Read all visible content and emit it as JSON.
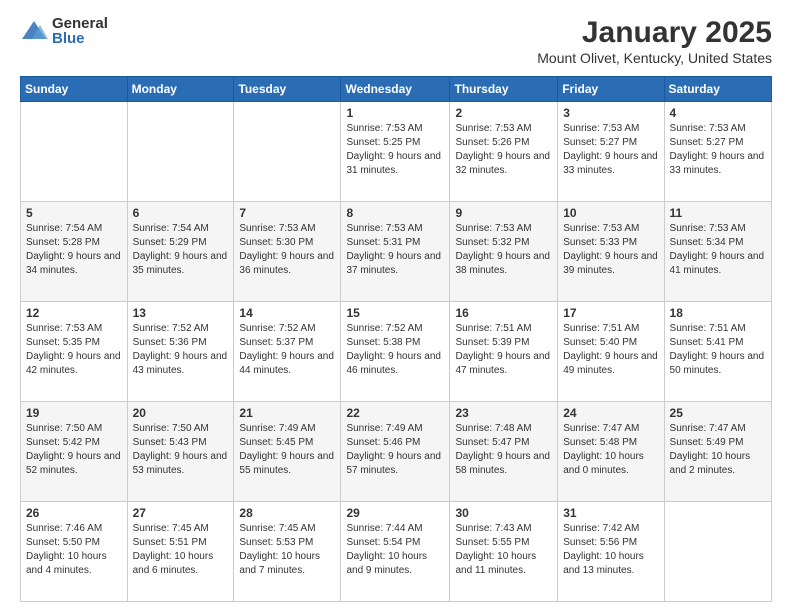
{
  "logo": {
    "general": "General",
    "blue": "Blue"
  },
  "header": {
    "month": "January 2025",
    "location": "Mount Olivet, Kentucky, United States"
  },
  "weekdays": [
    "Sunday",
    "Monday",
    "Tuesday",
    "Wednesday",
    "Thursday",
    "Friday",
    "Saturday"
  ],
  "weeks": [
    [
      {
        "day": "",
        "details": ""
      },
      {
        "day": "",
        "details": ""
      },
      {
        "day": "",
        "details": ""
      },
      {
        "day": "1",
        "details": "Sunrise: 7:53 AM\nSunset: 5:25 PM\nDaylight: 9 hours and 31 minutes."
      },
      {
        "day": "2",
        "details": "Sunrise: 7:53 AM\nSunset: 5:26 PM\nDaylight: 9 hours and 32 minutes."
      },
      {
        "day": "3",
        "details": "Sunrise: 7:53 AM\nSunset: 5:27 PM\nDaylight: 9 hours and 33 minutes."
      },
      {
        "day": "4",
        "details": "Sunrise: 7:53 AM\nSunset: 5:27 PM\nDaylight: 9 hours and 33 minutes."
      }
    ],
    [
      {
        "day": "5",
        "details": "Sunrise: 7:54 AM\nSunset: 5:28 PM\nDaylight: 9 hours and 34 minutes."
      },
      {
        "day": "6",
        "details": "Sunrise: 7:54 AM\nSunset: 5:29 PM\nDaylight: 9 hours and 35 minutes."
      },
      {
        "day": "7",
        "details": "Sunrise: 7:53 AM\nSunset: 5:30 PM\nDaylight: 9 hours and 36 minutes."
      },
      {
        "day": "8",
        "details": "Sunrise: 7:53 AM\nSunset: 5:31 PM\nDaylight: 9 hours and 37 minutes."
      },
      {
        "day": "9",
        "details": "Sunrise: 7:53 AM\nSunset: 5:32 PM\nDaylight: 9 hours and 38 minutes."
      },
      {
        "day": "10",
        "details": "Sunrise: 7:53 AM\nSunset: 5:33 PM\nDaylight: 9 hours and 39 minutes."
      },
      {
        "day": "11",
        "details": "Sunrise: 7:53 AM\nSunset: 5:34 PM\nDaylight: 9 hours and 41 minutes."
      }
    ],
    [
      {
        "day": "12",
        "details": "Sunrise: 7:53 AM\nSunset: 5:35 PM\nDaylight: 9 hours and 42 minutes."
      },
      {
        "day": "13",
        "details": "Sunrise: 7:52 AM\nSunset: 5:36 PM\nDaylight: 9 hours and 43 minutes."
      },
      {
        "day": "14",
        "details": "Sunrise: 7:52 AM\nSunset: 5:37 PM\nDaylight: 9 hours and 44 minutes."
      },
      {
        "day": "15",
        "details": "Sunrise: 7:52 AM\nSunset: 5:38 PM\nDaylight: 9 hours and 46 minutes."
      },
      {
        "day": "16",
        "details": "Sunrise: 7:51 AM\nSunset: 5:39 PM\nDaylight: 9 hours and 47 minutes."
      },
      {
        "day": "17",
        "details": "Sunrise: 7:51 AM\nSunset: 5:40 PM\nDaylight: 9 hours and 49 minutes."
      },
      {
        "day": "18",
        "details": "Sunrise: 7:51 AM\nSunset: 5:41 PM\nDaylight: 9 hours and 50 minutes."
      }
    ],
    [
      {
        "day": "19",
        "details": "Sunrise: 7:50 AM\nSunset: 5:42 PM\nDaylight: 9 hours and 52 minutes."
      },
      {
        "day": "20",
        "details": "Sunrise: 7:50 AM\nSunset: 5:43 PM\nDaylight: 9 hours and 53 minutes."
      },
      {
        "day": "21",
        "details": "Sunrise: 7:49 AM\nSunset: 5:45 PM\nDaylight: 9 hours and 55 minutes."
      },
      {
        "day": "22",
        "details": "Sunrise: 7:49 AM\nSunset: 5:46 PM\nDaylight: 9 hours and 57 minutes."
      },
      {
        "day": "23",
        "details": "Sunrise: 7:48 AM\nSunset: 5:47 PM\nDaylight: 9 hours and 58 minutes."
      },
      {
        "day": "24",
        "details": "Sunrise: 7:47 AM\nSunset: 5:48 PM\nDaylight: 10 hours and 0 minutes."
      },
      {
        "day": "25",
        "details": "Sunrise: 7:47 AM\nSunset: 5:49 PM\nDaylight: 10 hours and 2 minutes."
      }
    ],
    [
      {
        "day": "26",
        "details": "Sunrise: 7:46 AM\nSunset: 5:50 PM\nDaylight: 10 hours and 4 minutes."
      },
      {
        "day": "27",
        "details": "Sunrise: 7:45 AM\nSunset: 5:51 PM\nDaylight: 10 hours and 6 minutes."
      },
      {
        "day": "28",
        "details": "Sunrise: 7:45 AM\nSunset: 5:53 PM\nDaylight: 10 hours and 7 minutes."
      },
      {
        "day": "29",
        "details": "Sunrise: 7:44 AM\nSunset: 5:54 PM\nDaylight: 10 hours and 9 minutes."
      },
      {
        "day": "30",
        "details": "Sunrise: 7:43 AM\nSunset: 5:55 PM\nDaylight: 10 hours and 11 minutes."
      },
      {
        "day": "31",
        "details": "Sunrise: 7:42 AM\nSunset: 5:56 PM\nDaylight: 10 hours and 13 minutes."
      },
      {
        "day": "",
        "details": ""
      }
    ]
  ]
}
